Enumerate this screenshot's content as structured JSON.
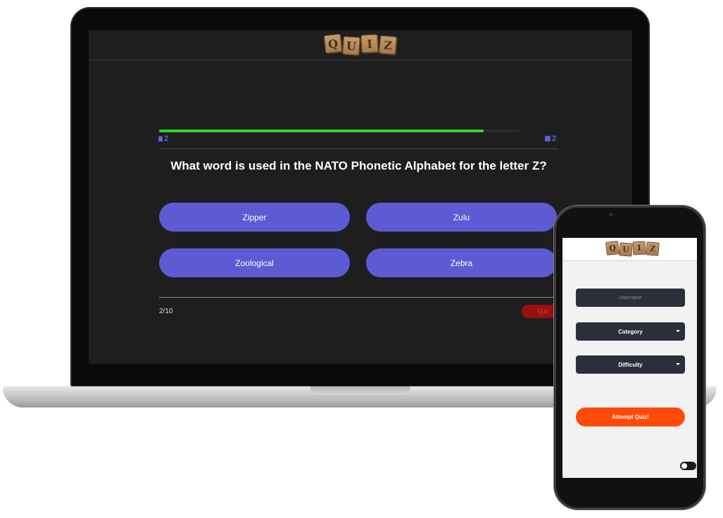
{
  "laptop": {
    "logo_letters": [
      "Q",
      "U",
      "I",
      "Z"
    ],
    "progress_fraction": 0.9,
    "progress_color": "#39d12a",
    "stat_left_icon": "lightbulb-icon",
    "stat_left_value": "2",
    "stat_right_icon": "square-icon",
    "stat_right_value": "2",
    "question": "What word is used in the NATO Phonetic Alphabet for the letter Z?",
    "answers": [
      "Zipper",
      "Zulu",
      "Zoological",
      "Zebra"
    ],
    "counter": "2/10",
    "quit_label": "Quit",
    "accent_color": "#5d5bd4"
  },
  "phone": {
    "logo_letters": [
      "Q",
      "U",
      "I",
      "Z"
    ],
    "username_placeholder": "Username",
    "category_label": "Category",
    "difficulty_label": "Difficulty",
    "attempt_label": "Attempt Quiz!",
    "attempt_color": "#ff4a0a",
    "theme_toggle_on": false
  }
}
